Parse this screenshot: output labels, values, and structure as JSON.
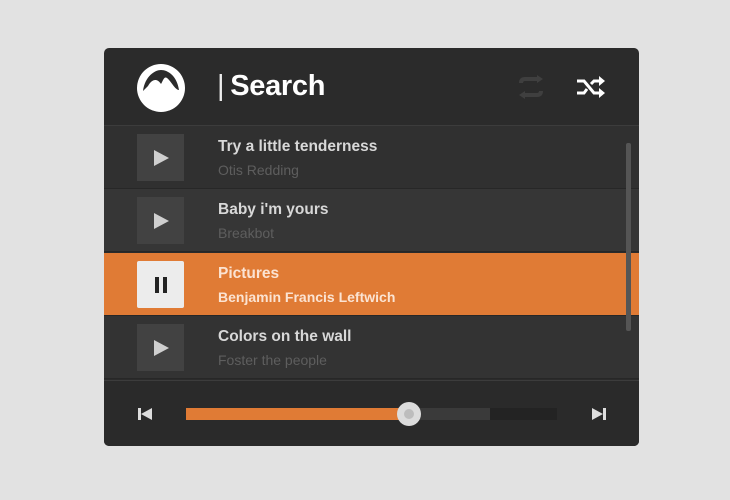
{
  "header": {
    "title": "Search",
    "logo": "grooveshark-logo",
    "repeat_icon": "repeat-icon",
    "shuffle_icon": "shuffle-icon"
  },
  "tracks": [
    {
      "title": "Try a little tenderness",
      "artist": "Otis Redding",
      "state": "play"
    },
    {
      "title": "Baby i'm yours",
      "artist": "Breakbot",
      "state": "play"
    },
    {
      "title": "Pictures",
      "artist": "Benjamin Francis Leftwich",
      "state": "pause"
    },
    {
      "title": "Colors on the wall",
      "artist": "Foster the people",
      "state": "play"
    }
  ],
  "player": {
    "progress": 0.6,
    "buffered": 0.82
  },
  "colors": {
    "accent": "#e07b35",
    "panel": "#2b2b2b",
    "background": "#e2e2e2"
  }
}
